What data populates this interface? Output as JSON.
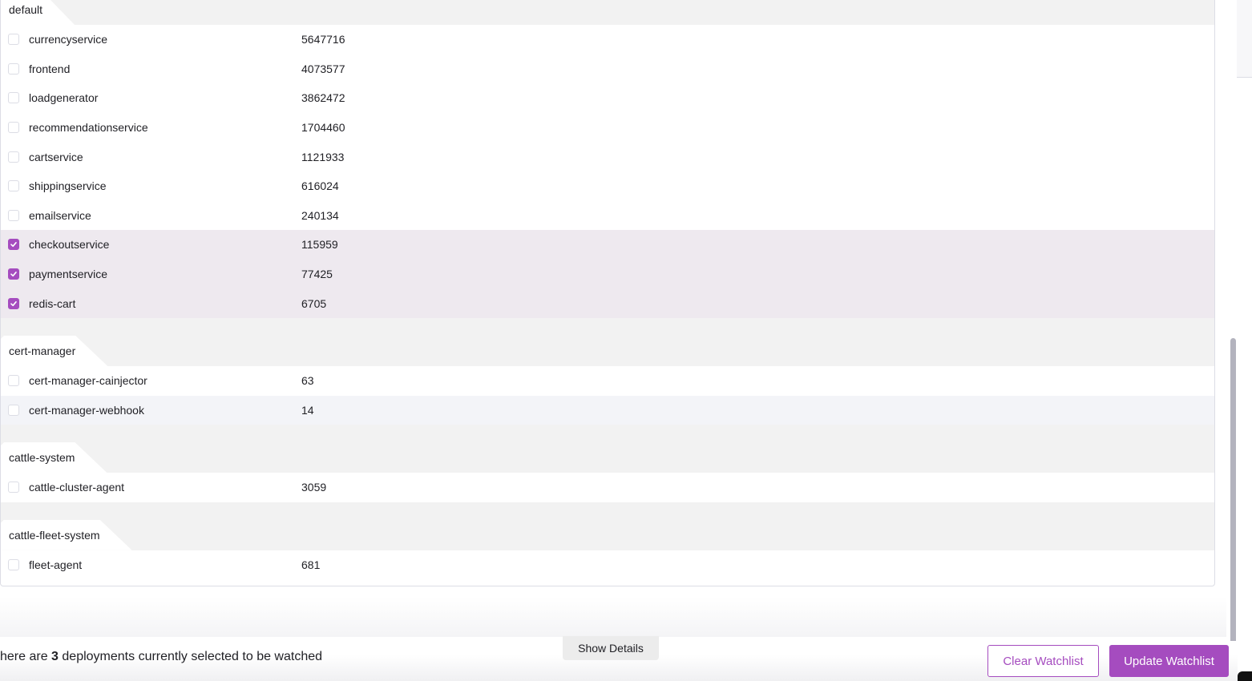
{
  "groups": [
    {
      "name": "default",
      "deployments": [
        {
          "name": "currencyservice",
          "count": "5647716",
          "checked": false
        },
        {
          "name": "frontend",
          "count": "4073577",
          "checked": false
        },
        {
          "name": "loadgenerator",
          "count": "3862472",
          "checked": false
        },
        {
          "name": "recommendationservice",
          "count": "1704460",
          "checked": false
        },
        {
          "name": "cartservice",
          "count": "1121933",
          "checked": false
        },
        {
          "name": "shippingservice",
          "count": "616024",
          "checked": false
        },
        {
          "name": "emailservice",
          "count": "240134",
          "checked": false
        },
        {
          "name": "checkoutservice",
          "count": "115959",
          "checked": true
        },
        {
          "name": "paymentservice",
          "count": "77425",
          "checked": true
        },
        {
          "name": "redis-cart",
          "count": "6705",
          "checked": true
        }
      ]
    },
    {
      "name": "cert-manager",
      "deployments": [
        {
          "name": "cert-manager-cainjector",
          "count": "63",
          "checked": false
        },
        {
          "name": "cert-manager-webhook",
          "count": "14",
          "checked": false,
          "hover": true
        }
      ]
    },
    {
      "name": "cattle-system",
      "deployments": [
        {
          "name": "cattle-cluster-agent",
          "count": "3059",
          "checked": false
        }
      ]
    },
    {
      "name": "cattle-fleet-system",
      "deployments": [
        {
          "name": "fleet-agent",
          "count": "681",
          "checked": false
        }
      ]
    }
  ],
  "footer": {
    "status_prefix": "here are ",
    "selected_count": "3",
    "status_suffix": " deployments currently selected to be watched",
    "show_details_label": "Show Details",
    "clear_label": "Clear Watchlist",
    "update_label": "Update Watchlist"
  },
  "colors": {
    "accent": "#a54cbf",
    "selected_row": "#eee9ef",
    "group_header_bg": "#f2f2f2"
  }
}
